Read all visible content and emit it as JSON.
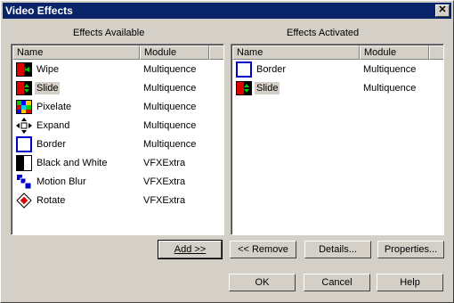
{
  "window": {
    "title": "Video Effects",
    "close": "✕"
  },
  "available": {
    "label": "Effects Available",
    "col_name": "Name",
    "col_module": "Module",
    "items": [
      {
        "name": "Wipe",
        "module": "Multiquence",
        "icon": "wipe-icon"
      },
      {
        "name": "Slide",
        "module": "Multiquence",
        "icon": "slide-icon"
      },
      {
        "name": "Pixelate",
        "module": "Multiquence",
        "icon": "pixelate-icon"
      },
      {
        "name": "Expand",
        "module": "Multiquence",
        "icon": "expand-icon"
      },
      {
        "name": "Border",
        "module": "Multiquence",
        "icon": "border-icon"
      },
      {
        "name": "Black and White",
        "module": "VFXExtra",
        "icon": "black-white-icon"
      },
      {
        "name": "Motion Blur",
        "module": "VFXExtra",
        "icon": "motion-blur-icon"
      },
      {
        "name": "Rotate",
        "module": "VFXExtra",
        "icon": "rotate-icon"
      }
    ]
  },
  "activated": {
    "label": "Effects Activated",
    "col_name": "Name",
    "col_module": "Module",
    "items": [
      {
        "name": "Border",
        "module": "Multiquence",
        "icon": "border-icon"
      },
      {
        "name": "Slide",
        "module": "Multiquence",
        "icon": "slide-icon"
      }
    ]
  },
  "buttons": {
    "add": "Add >>",
    "remove": "<< Remove",
    "details": "Details...",
    "properties": "Properties...",
    "ok": "OK",
    "cancel": "Cancel",
    "help": "Help"
  }
}
